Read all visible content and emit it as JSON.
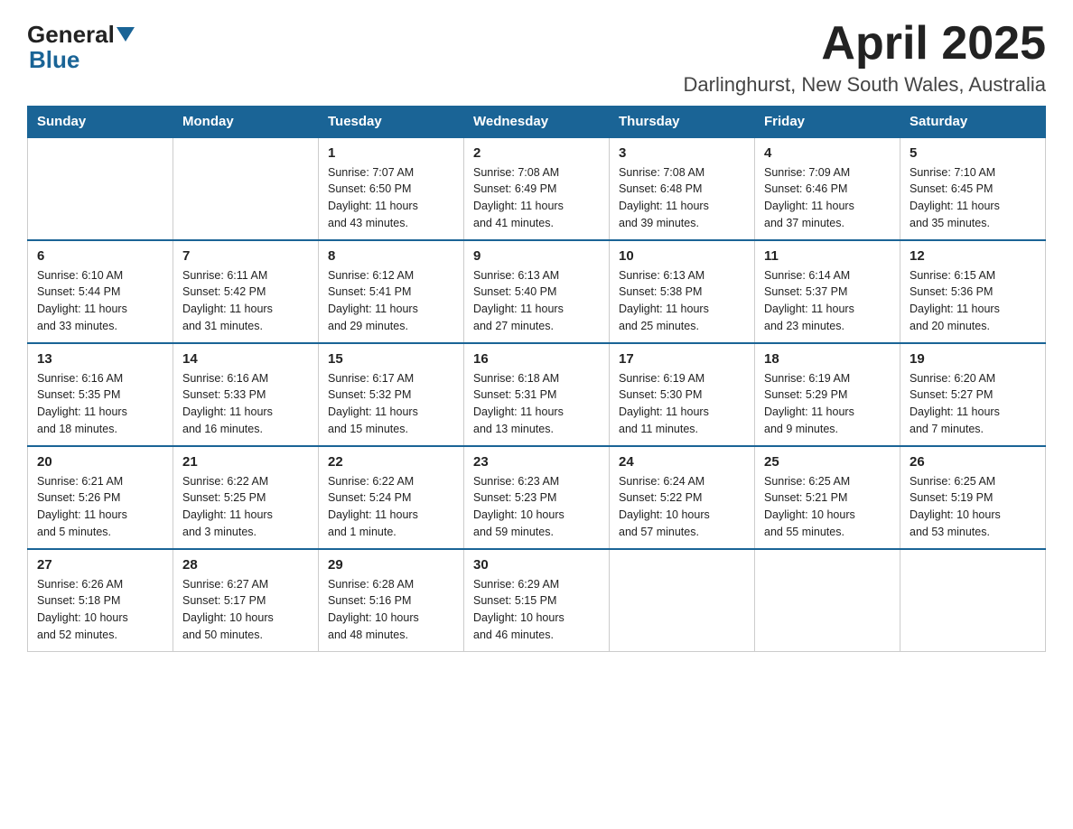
{
  "header": {
    "logo_general": "General",
    "logo_blue": "Blue",
    "month_title": "April 2025",
    "location": "Darlinghurst, New South Wales, Australia"
  },
  "days_of_week": [
    "Sunday",
    "Monday",
    "Tuesday",
    "Wednesday",
    "Thursday",
    "Friday",
    "Saturday"
  ],
  "weeks": [
    [
      {
        "day": "",
        "info": ""
      },
      {
        "day": "",
        "info": ""
      },
      {
        "day": "1",
        "info": "Sunrise: 7:07 AM\nSunset: 6:50 PM\nDaylight: 11 hours\nand 43 minutes."
      },
      {
        "day": "2",
        "info": "Sunrise: 7:08 AM\nSunset: 6:49 PM\nDaylight: 11 hours\nand 41 minutes."
      },
      {
        "day": "3",
        "info": "Sunrise: 7:08 AM\nSunset: 6:48 PM\nDaylight: 11 hours\nand 39 minutes."
      },
      {
        "day": "4",
        "info": "Sunrise: 7:09 AM\nSunset: 6:46 PM\nDaylight: 11 hours\nand 37 minutes."
      },
      {
        "day": "5",
        "info": "Sunrise: 7:10 AM\nSunset: 6:45 PM\nDaylight: 11 hours\nand 35 minutes."
      }
    ],
    [
      {
        "day": "6",
        "info": "Sunrise: 6:10 AM\nSunset: 5:44 PM\nDaylight: 11 hours\nand 33 minutes."
      },
      {
        "day": "7",
        "info": "Sunrise: 6:11 AM\nSunset: 5:42 PM\nDaylight: 11 hours\nand 31 minutes."
      },
      {
        "day": "8",
        "info": "Sunrise: 6:12 AM\nSunset: 5:41 PM\nDaylight: 11 hours\nand 29 minutes."
      },
      {
        "day": "9",
        "info": "Sunrise: 6:13 AM\nSunset: 5:40 PM\nDaylight: 11 hours\nand 27 minutes."
      },
      {
        "day": "10",
        "info": "Sunrise: 6:13 AM\nSunset: 5:38 PM\nDaylight: 11 hours\nand 25 minutes."
      },
      {
        "day": "11",
        "info": "Sunrise: 6:14 AM\nSunset: 5:37 PM\nDaylight: 11 hours\nand 23 minutes."
      },
      {
        "day": "12",
        "info": "Sunrise: 6:15 AM\nSunset: 5:36 PM\nDaylight: 11 hours\nand 20 minutes."
      }
    ],
    [
      {
        "day": "13",
        "info": "Sunrise: 6:16 AM\nSunset: 5:35 PM\nDaylight: 11 hours\nand 18 minutes."
      },
      {
        "day": "14",
        "info": "Sunrise: 6:16 AM\nSunset: 5:33 PM\nDaylight: 11 hours\nand 16 minutes."
      },
      {
        "day": "15",
        "info": "Sunrise: 6:17 AM\nSunset: 5:32 PM\nDaylight: 11 hours\nand 15 minutes."
      },
      {
        "day": "16",
        "info": "Sunrise: 6:18 AM\nSunset: 5:31 PM\nDaylight: 11 hours\nand 13 minutes."
      },
      {
        "day": "17",
        "info": "Sunrise: 6:19 AM\nSunset: 5:30 PM\nDaylight: 11 hours\nand 11 minutes."
      },
      {
        "day": "18",
        "info": "Sunrise: 6:19 AM\nSunset: 5:29 PM\nDaylight: 11 hours\nand 9 minutes."
      },
      {
        "day": "19",
        "info": "Sunrise: 6:20 AM\nSunset: 5:27 PM\nDaylight: 11 hours\nand 7 minutes."
      }
    ],
    [
      {
        "day": "20",
        "info": "Sunrise: 6:21 AM\nSunset: 5:26 PM\nDaylight: 11 hours\nand 5 minutes."
      },
      {
        "day": "21",
        "info": "Sunrise: 6:22 AM\nSunset: 5:25 PM\nDaylight: 11 hours\nand 3 minutes."
      },
      {
        "day": "22",
        "info": "Sunrise: 6:22 AM\nSunset: 5:24 PM\nDaylight: 11 hours\nand 1 minute."
      },
      {
        "day": "23",
        "info": "Sunrise: 6:23 AM\nSunset: 5:23 PM\nDaylight: 10 hours\nand 59 minutes."
      },
      {
        "day": "24",
        "info": "Sunrise: 6:24 AM\nSunset: 5:22 PM\nDaylight: 10 hours\nand 57 minutes."
      },
      {
        "day": "25",
        "info": "Sunrise: 6:25 AM\nSunset: 5:21 PM\nDaylight: 10 hours\nand 55 minutes."
      },
      {
        "day": "26",
        "info": "Sunrise: 6:25 AM\nSunset: 5:19 PM\nDaylight: 10 hours\nand 53 minutes."
      }
    ],
    [
      {
        "day": "27",
        "info": "Sunrise: 6:26 AM\nSunset: 5:18 PM\nDaylight: 10 hours\nand 52 minutes."
      },
      {
        "day": "28",
        "info": "Sunrise: 6:27 AM\nSunset: 5:17 PM\nDaylight: 10 hours\nand 50 minutes."
      },
      {
        "day": "29",
        "info": "Sunrise: 6:28 AM\nSunset: 5:16 PM\nDaylight: 10 hours\nand 48 minutes."
      },
      {
        "day": "30",
        "info": "Sunrise: 6:29 AM\nSunset: 5:15 PM\nDaylight: 10 hours\nand 46 minutes."
      },
      {
        "day": "",
        "info": ""
      },
      {
        "day": "",
        "info": ""
      },
      {
        "day": "",
        "info": ""
      }
    ]
  ],
  "colors": {
    "header_bg": "#1a6496",
    "header_text": "#ffffff",
    "border": "#1a6496"
  }
}
